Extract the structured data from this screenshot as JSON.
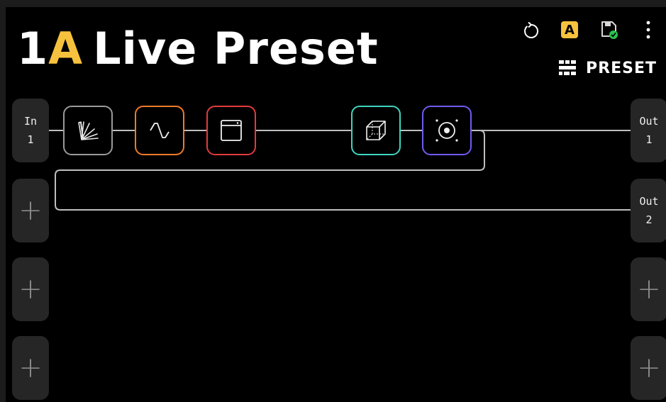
{
  "preset": {
    "number": "1",
    "bank": "A",
    "name": "Live Preset"
  },
  "toolbar": {
    "undo_icon": "undo-icon",
    "bank_label": "A",
    "save_icon": "save-confirmed-icon",
    "more_icon": "more-vertical-icon",
    "view_icon": "grid-view-icon",
    "view_label": "PRESET"
  },
  "inputs": [
    {
      "label": "In",
      "number": "1"
    },
    {
      "label": "",
      "number": "",
      "empty_icon": "plus-icon"
    },
    {
      "label": "",
      "number": "",
      "empty_icon": "plus-icon"
    },
    {
      "label": "",
      "number": "",
      "empty_icon": "plus-icon"
    }
  ],
  "outputs": [
    {
      "label": "Out",
      "number": "1"
    },
    {
      "label": "Out",
      "number": "2"
    },
    {
      "label": "",
      "number": "",
      "empty_icon": "plus-icon"
    },
    {
      "label": "",
      "number": "",
      "empty_icon": "plus-icon"
    }
  ],
  "chain": [
    {
      "icon": "dynamics-fan-icon",
      "color": "#9a9a9a"
    },
    {
      "icon": "filter-wave-icon",
      "color": "#f07a2a"
    },
    {
      "icon": "amp-cabinet-icon",
      "color": "#e23b3b"
    },
    {
      "icon": "cube-icon",
      "color": "#3fd6bf"
    },
    {
      "icon": "speaker-icon",
      "color": "#6f5cf0"
    }
  ],
  "colors": {
    "bank_accent": "#f6c23e",
    "background": "#000000",
    "port_bg": "#262626",
    "wire": "#bfbfbf"
  }
}
